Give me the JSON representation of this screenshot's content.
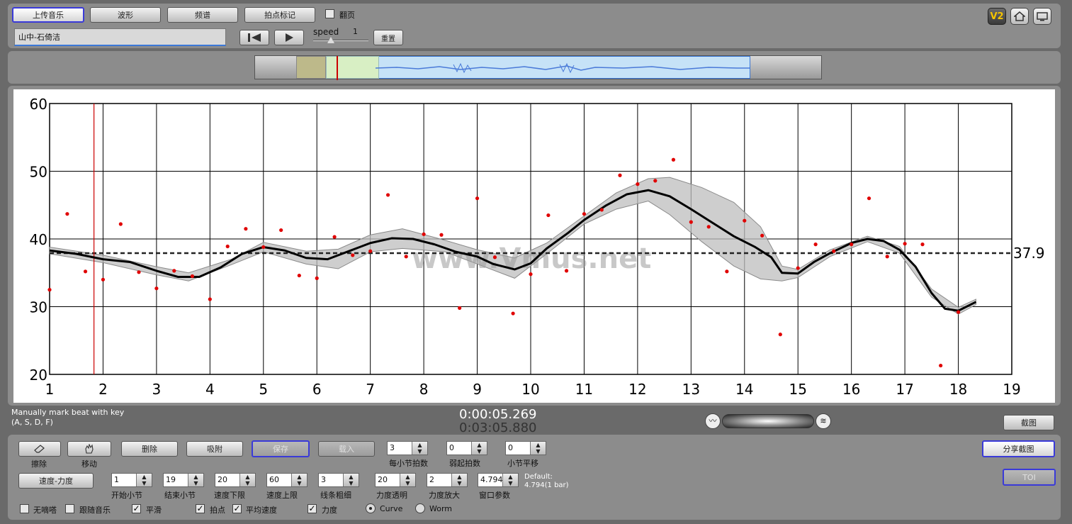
{
  "toolbar": {
    "upload_label": "上传音乐",
    "waveform_label": "波形",
    "spectrum_label": "频谱",
    "beatmark_label": "拍点标记",
    "flip_label": "翻页",
    "track_name": "山中-石倚洁",
    "speed_label": "speed",
    "speed_value": "1",
    "reset_label": "重置",
    "logo_text": "V2"
  },
  "overview": {
    "accent": "#3b78d8"
  },
  "chart_data": {
    "type": "scatter",
    "xlim": [
      1,
      19
    ],
    "ylim": [
      20,
      60
    ],
    "x_ticks": [
      "1",
      "2",
      "3",
      "4",
      "5",
      "6",
      "7",
      "8",
      "9",
      "10",
      "11",
      "12",
      "13",
      "14",
      "15",
      "16",
      "17",
      "18",
      "19"
    ],
    "y_ticks": [
      "20",
      "30",
      "40",
      "50",
      "60"
    ],
    "average": 37.9,
    "average_label": "37.9",
    "cursor_x": 1.83,
    "watermark": "www.Vmus.net",
    "points": [
      [
        1.0,
        32.5
      ],
      [
        1.33,
        43.7
      ],
      [
        1.67,
        35.2
      ],
      [
        2.0,
        34.0
      ],
      [
        2.33,
        42.2
      ],
      [
        2.67,
        35.1
      ],
      [
        3.0,
        32.7
      ],
      [
        3.33,
        35.3
      ],
      [
        3.67,
        34.5
      ],
      [
        4.0,
        31.1
      ],
      [
        4.33,
        38.9
      ],
      [
        4.67,
        41.5
      ],
      [
        5.0,
        38.8
      ],
      [
        5.33,
        41.3
      ],
      [
        5.67,
        34.6
      ],
      [
        6.0,
        34.2
      ],
      [
        6.33,
        40.3
      ],
      [
        6.67,
        37.6
      ],
      [
        7.0,
        38.2
      ],
      [
        7.33,
        46.5
      ],
      [
        7.67,
        37.4
      ],
      [
        8.0,
        40.7
      ],
      [
        8.33,
        40.6
      ],
      [
        8.67,
        29.8
      ],
      [
        9.0,
        46.0
      ],
      [
        9.33,
        37.3
      ],
      [
        9.67,
        29.0
      ],
      [
        10.0,
        34.8
      ],
      [
        10.33,
        43.5
      ],
      [
        10.67,
        35.3
      ],
      [
        11.0,
        43.7
      ],
      [
        11.33,
        44.3
      ],
      [
        11.67,
        49.4
      ],
      [
        12.0,
        48.1
      ],
      [
        12.33,
        48.6
      ],
      [
        12.67,
        51.7
      ],
      [
        13.0,
        42.5
      ],
      [
        13.33,
        41.8
      ],
      [
        13.67,
        35.2
      ],
      [
        14.0,
        42.7
      ],
      [
        14.33,
        40.5
      ],
      [
        14.67,
        25.9
      ],
      [
        15.0,
        35.7
      ],
      [
        15.33,
        39.2
      ],
      [
        15.67,
        38.2
      ],
      [
        16.0,
        39.2
      ],
      [
        16.33,
        46.0
      ],
      [
        16.67,
        37.4
      ],
      [
        17.0,
        39.3
      ],
      [
        17.33,
        39.2
      ],
      [
        17.67,
        21.3
      ],
      [
        18.0,
        29.2
      ]
    ],
    "curve": [
      [
        1.0,
        38.3
      ],
      [
        1.5,
        37.8
      ],
      [
        2.0,
        37.0
      ],
      [
        2.5,
        36.6
      ],
      [
        3.0,
        35.3
      ],
      [
        3.4,
        34.4
      ],
      [
        3.8,
        34.4
      ],
      [
        4.2,
        35.8
      ],
      [
        4.6,
        37.8
      ],
      [
        5.0,
        38.8
      ],
      [
        5.4,
        38.3
      ],
      [
        5.8,
        37.2
      ],
      [
        6.2,
        37.0
      ],
      [
        6.6,
        38.2
      ],
      [
        7.0,
        39.4
      ],
      [
        7.4,
        40.1
      ],
      [
        7.8,
        40.0
      ],
      [
        8.2,
        39.2
      ],
      [
        8.6,
        38.1
      ],
      [
        9.0,
        37.4
      ],
      [
        9.3,
        36.3
      ],
      [
        9.7,
        35.5
      ],
      [
        10.0,
        36.4
      ],
      [
        10.3,
        38.6
      ],
      [
        10.7,
        40.9
      ],
      [
        11.0,
        42.8
      ],
      [
        11.4,
        44.9
      ],
      [
        11.8,
        46.6
      ],
      [
        12.2,
        47.2
      ],
      [
        12.6,
        46.3
      ],
      [
        13.0,
        44.4
      ],
      [
        13.4,
        42.4
      ],
      [
        13.8,
        40.4
      ],
      [
        14.2,
        38.8
      ],
      [
        14.5,
        37.3
      ],
      [
        14.7,
        35.0
      ],
      [
        15.0,
        34.9
      ],
      [
        15.3,
        36.6
      ],
      [
        15.6,
        37.9
      ],
      [
        16.0,
        39.4
      ],
      [
        16.3,
        40.0
      ],
      [
        16.6,
        39.7
      ],
      [
        16.9,
        38.4
      ],
      [
        17.2,
        35.9
      ],
      [
        17.5,
        32.0
      ],
      [
        17.75,
        29.7
      ],
      [
        18.0,
        29.4
      ],
      [
        18.33,
        30.7
      ]
    ],
    "band_upper": [
      [
        1.0,
        38.8
      ],
      [
        2.0,
        37.6
      ],
      [
        3.0,
        35.9
      ],
      [
        3.6,
        35.0
      ],
      [
        4.4,
        37.0
      ],
      [
        5.0,
        39.5
      ],
      [
        5.8,
        38.2
      ],
      [
        6.4,
        38.5
      ],
      [
        7.0,
        40.6
      ],
      [
        7.6,
        41.5
      ],
      [
        8.4,
        39.8
      ],
      [
        9.0,
        38.4
      ],
      [
        9.7,
        37.2
      ],
      [
        10.3,
        39.4
      ],
      [
        11.0,
        43.4
      ],
      [
        11.6,
        46.8
      ],
      [
        12.2,
        48.9
      ],
      [
        12.6,
        49.1
      ],
      [
        13.2,
        47.6
      ],
      [
        13.8,
        45.4
      ],
      [
        14.3,
        41.8
      ],
      [
        14.7,
        36.0
      ],
      [
        15.0,
        35.5
      ],
      [
        15.6,
        38.4
      ],
      [
        16.3,
        40.4
      ],
      [
        16.9,
        38.9
      ],
      [
        17.5,
        32.6
      ],
      [
        18.0,
        29.9
      ],
      [
        18.33,
        31.1
      ]
    ],
    "band_lower": [
      [
        1.0,
        37.8
      ],
      [
        2.0,
        36.5
      ],
      [
        3.0,
        34.7
      ],
      [
        3.6,
        33.8
      ],
      [
        4.4,
        36.2
      ],
      [
        5.0,
        38.1
      ],
      [
        5.8,
        36.3
      ],
      [
        6.4,
        35.6
      ],
      [
        7.0,
        38.1
      ],
      [
        7.6,
        38.6
      ],
      [
        8.4,
        38.1
      ],
      [
        9.0,
        36.3
      ],
      [
        9.7,
        34.2
      ],
      [
        10.3,
        37.8
      ],
      [
        11.0,
        42.2
      ],
      [
        11.6,
        44.4
      ],
      [
        12.2,
        45.6
      ],
      [
        12.6,
        43.6
      ],
      [
        13.2,
        39.6
      ],
      [
        13.8,
        36.0
      ],
      [
        14.3,
        34.1
      ],
      [
        14.7,
        33.8
      ],
      [
        15.0,
        34.3
      ],
      [
        15.6,
        37.4
      ],
      [
        16.3,
        39.6
      ],
      [
        16.9,
        37.9
      ],
      [
        17.5,
        31.4
      ],
      [
        18.0,
        28.9
      ],
      [
        18.33,
        30.3
      ]
    ]
  },
  "status": {
    "hint_line1": "Manually mark beat with key",
    "hint_line2": "(A, S, D, F)",
    "time_current": "0:00:05.269",
    "time_total": "0:03:05.880",
    "screenshot_label": "截图"
  },
  "controls": {
    "erase_label": "擦除",
    "move_label": "移动",
    "delete_label": "删除",
    "snap_label": "吸附",
    "save_label": "保存",
    "load_label": "载入",
    "beats_per_bar": {
      "value": "3",
      "label": "每小节拍数"
    },
    "weak_beats": {
      "value": "0",
      "label": "弱起拍数"
    },
    "bar_shift": {
      "value": "0",
      "label": "小节平移"
    },
    "share_label": "分享截图",
    "mode_label": "速度-力度",
    "start_bar": {
      "value": "1",
      "label": "开始小节"
    },
    "end_bar": {
      "value": "19",
      "label": "结束小节"
    },
    "speed_min": {
      "value": "20",
      "label": "速度下限"
    },
    "speed_max": {
      "value": "60",
      "label": "速度上限"
    },
    "line_width": {
      "value": "3",
      "label": "线条粗细"
    },
    "dyn_alpha": {
      "value": "20",
      "label": "力度透明"
    },
    "dyn_scale": {
      "value": "2",
      "label": "力度放大"
    },
    "window_param": {
      "value": "4.794",
      "label": "窗口参数"
    },
    "default_line1": "Default:",
    "default_line2": "4.794(1 bar)",
    "toi_label": "TOI",
    "opt_silent": "无嘀嗒",
    "opt_follow": "跟随音乐",
    "opt_smooth": "平滑",
    "opt_beat": "拍点",
    "opt_avg_speed": "平均速度",
    "opt_dynamics": "力度",
    "opt_curve": "Curve",
    "opt_worm": "Worm"
  }
}
